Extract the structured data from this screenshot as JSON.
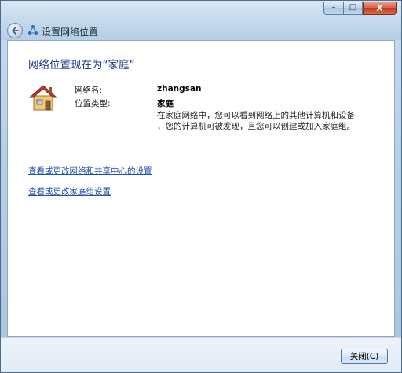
{
  "window": {
    "title": "设置网络位置",
    "controls": {
      "minimize": "–",
      "maximize": "□",
      "close": "X"
    }
  },
  "main": {
    "heading": "网络位置现在为“家庭”",
    "network_name_label": "网络名:",
    "network_name_value": "zhangsan",
    "location_type_label": "位置类型:",
    "location_type_value": "家庭",
    "description_line1": "在家庭网络中，您可以看到网络上的其他计算机和设备",
    "description_line2": "，您的计算机可被发现，且您可以创建或加入家庭组。",
    "link_network_sharing": "查看或更改网络和共享中心的设置",
    "link_homegroup": "查看或更改家庭组设置"
  },
  "footer": {
    "close_button_label": "关闭(C)"
  },
  "icons": {
    "back": "back-arrow-icon",
    "title": "network-icon",
    "location": "house-icon"
  },
  "colors": {
    "heading": "#1e3a8a",
    "link": "#1f4fb0",
    "house_roof": "#c0392b",
    "house_wall": "#f0c070"
  }
}
